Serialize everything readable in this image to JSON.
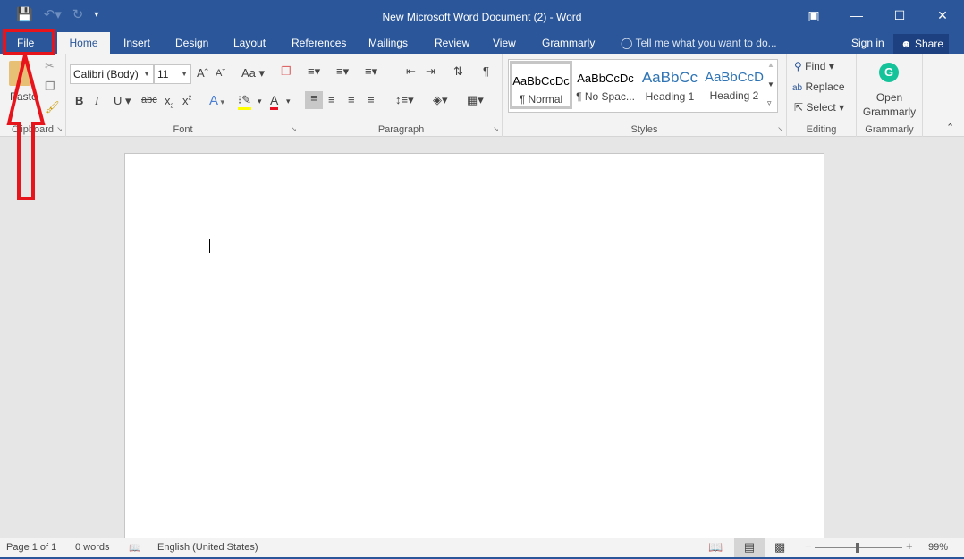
{
  "window": {
    "title": "New Microsoft Word Document (2) - Word"
  },
  "qat": {
    "save_icon": "save-icon",
    "undo_icon": "undo-icon",
    "redo_icon": "redo-icon",
    "customize_icon": "customize-qat-icon"
  },
  "window_controls": {
    "ribbon_display": "ribbon-display-options-icon",
    "minimize": "minimize-icon",
    "maximize": "maximize-icon",
    "close": "close-icon"
  },
  "tabs": [
    {
      "label": "File"
    },
    {
      "label": "Home"
    },
    {
      "label": "Insert"
    },
    {
      "label": "Design"
    },
    {
      "label": "Layout"
    },
    {
      "label": "References"
    },
    {
      "label": "Mailings"
    },
    {
      "label": "Review"
    },
    {
      "label": "View"
    },
    {
      "label": "Grammarly"
    }
  ],
  "active_tab": "Home",
  "tell_me": "Tell me what you want to do...",
  "sign_in": "Sign in",
  "share": "Share",
  "clipboard": {
    "paste": "Paste",
    "group": "Clipboard"
  },
  "font": {
    "name": "Calibri (Body)",
    "size": "11",
    "group": "Font",
    "case_label": "Aa"
  },
  "paragraph": {
    "group": "Paragraph"
  },
  "styles": {
    "group": "Styles",
    "items": [
      {
        "preview": "AaBbCcDc",
        "name": "¶ Normal"
      },
      {
        "preview": "AaBbCcDc",
        "name": "¶ No Spac..."
      },
      {
        "preview": "AaBbCc",
        "name": "Heading 1"
      },
      {
        "preview": "AaBbCcD",
        "name": "Heading 2"
      }
    ]
  },
  "editing": {
    "group": "Editing",
    "find": "Find",
    "replace": "Replace",
    "select": "Select"
  },
  "grammarly": {
    "group": "Grammarly",
    "open_line1": "Open",
    "open_line2": "Grammarly"
  },
  "status": {
    "page": "Page 1 of 1",
    "words": "0 words",
    "language": "English (United States)",
    "zoom": "99%",
    "zoom_percent": 99
  },
  "colors": {
    "brand": "#2b579a",
    "annotation": "#e8141c",
    "grammarly": "#15c39a",
    "highlight": "#ffff00",
    "font_color": "#e81123"
  }
}
